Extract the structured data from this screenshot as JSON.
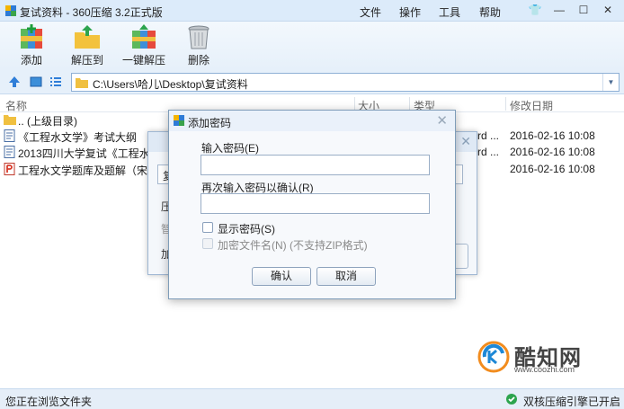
{
  "window": {
    "title": "复试资料 - 360压缩 3.2正式版",
    "menu": [
      "文件",
      "操作",
      "工具",
      "帮助"
    ]
  },
  "toolbar": {
    "add": "添加",
    "extract_to": "解压到",
    "one_click_extract": "一键解压",
    "delete": "删除"
  },
  "address": {
    "path": "C:\\Users\\哈儿\\Desktop\\复试资料"
  },
  "columns": {
    "name": "名称",
    "size": "大小",
    "type": "类型",
    "modified": "修改日期"
  },
  "files": [
    {
      "name": ".. (上级目录)",
      "type": "",
      "date": "",
      "icon": "folder-icon"
    },
    {
      "name": "《工程水文学》考试大纲",
      "type": "rd ...",
      "date": "2016-02-16 10:08",
      "icon": "word-doc-icon"
    },
    {
      "name": "2013四川大学复试《工程水文",
      "type": "rd ...",
      "date": "2016-02-16 10:08",
      "icon": "word-doc-icon"
    },
    {
      "name": "工程水文学题库及题解（宋星原",
      "type": "",
      "date": "2016-02-16 10:08",
      "icon": "pdf-icon"
    }
  ],
  "bg_dialog": {
    "frag_a": "复",
    "frag_b": "压",
    "frag_c": "智",
    "frag_d": "加"
  },
  "dialog": {
    "title": "添加密码",
    "password_label": "输入密码(E)",
    "confirm_label": "再次输入密码以确认(R)",
    "show_password": "显示密码(S)",
    "encrypt_filenames": "加密文件名(N) (不支持ZIP格式)",
    "ok": "确认",
    "cancel": "取消",
    "password_value": "",
    "confirm_value": ""
  },
  "watermark": {
    "brand": "酷知网",
    "url": "www.coozhi.com"
  },
  "status": {
    "left": "您正在浏览文件夹",
    "right": "双核压缩引擎已开启"
  }
}
